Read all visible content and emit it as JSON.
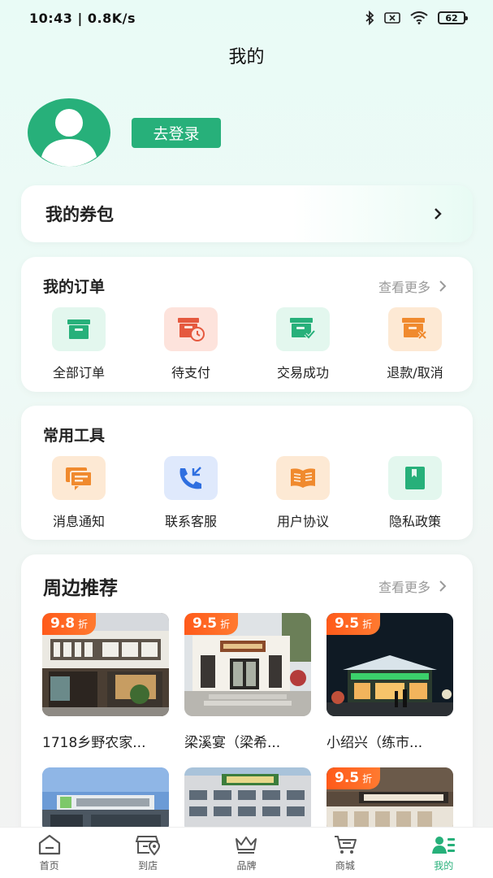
{
  "status_bar": {
    "time": "10:43 | 0.8K/s",
    "battery": "62"
  },
  "page": {
    "title": "我的"
  },
  "profile": {
    "login_label": "去登录"
  },
  "coupon": {
    "title": "我的券包"
  },
  "orders": {
    "title": "我的订单",
    "more": "查看更多",
    "items": [
      {
        "label": "全部订单",
        "icon": "box-icon",
        "color": "#27b07a",
        "bg": "#e3f7ee"
      },
      {
        "label": "待支付",
        "icon": "clock-box-icon",
        "color": "#e5593f",
        "bg": "#fde3dc"
      },
      {
        "label": "交易成功",
        "icon": "check-box-icon",
        "color": "#27b07a",
        "bg": "#e3f7ee"
      },
      {
        "label": "退款/取消",
        "icon": "cancel-box-icon",
        "color": "#f08a2e",
        "bg": "#fde9d4"
      }
    ]
  },
  "tools": {
    "title": "常用工具",
    "items": [
      {
        "label": "消息通知",
        "icon": "message-icon",
        "color": "#f08a2e",
        "bg": "#fde9d4"
      },
      {
        "label": "联系客服",
        "icon": "phone-icon",
        "color": "#2f6fe0",
        "bg": "#dfe9fc"
      },
      {
        "label": "用户协议",
        "icon": "book-icon",
        "color": "#f08a2e",
        "bg": "#fde9d4"
      },
      {
        "label": "隐私政策",
        "icon": "bookmark-icon",
        "color": "#27b07a",
        "bg": "#e3f7ee"
      }
    ]
  },
  "recommend": {
    "title": "周边推荐",
    "more": "查看更多",
    "shops": [
      {
        "name": "1718乡野农家...",
        "discount": "9.8",
        "unit": "折"
      },
      {
        "name": "梁溪宴（梁希...",
        "discount": "9.5",
        "unit": "折"
      },
      {
        "name": "小绍兴（练市...",
        "discount": "9.5",
        "unit": "折"
      },
      {
        "name": "",
        "discount": "",
        "unit": ""
      },
      {
        "name": "",
        "discount": "",
        "unit": ""
      },
      {
        "name": "",
        "discount": "9.5",
        "unit": "折"
      }
    ]
  },
  "tabbar": {
    "items": [
      {
        "label": "首页",
        "icon": "home-icon"
      },
      {
        "label": "到店",
        "icon": "store-location-icon"
      },
      {
        "label": "品牌",
        "icon": "crown-icon"
      },
      {
        "label": "商城",
        "icon": "cart-icon"
      },
      {
        "label": "我的",
        "icon": "profile-list-icon",
        "active": true
      }
    ]
  }
}
